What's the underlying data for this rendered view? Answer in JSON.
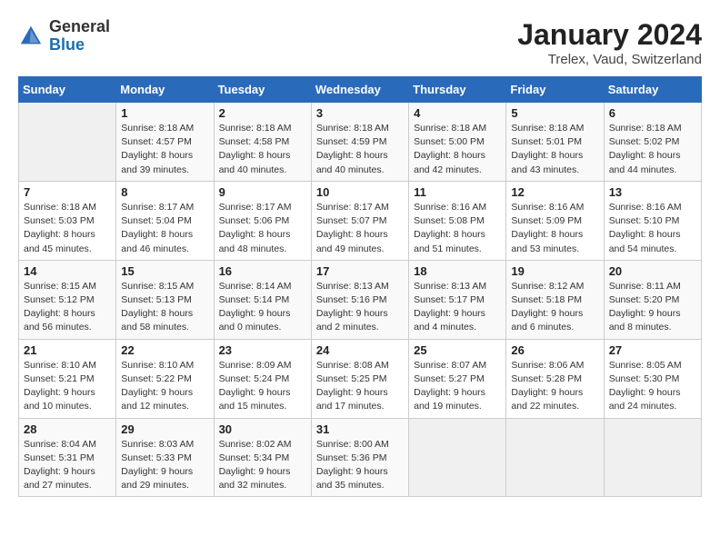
{
  "header": {
    "logo_general": "General",
    "logo_blue": "Blue",
    "title": "January 2024",
    "subtitle": "Trelex, Vaud, Switzerland"
  },
  "days_of_week": [
    "Sunday",
    "Monday",
    "Tuesday",
    "Wednesday",
    "Thursday",
    "Friday",
    "Saturday"
  ],
  "weeks": [
    [
      {
        "day": "",
        "sunrise": "",
        "sunset": "",
        "daylight": ""
      },
      {
        "day": "1",
        "sunrise": "Sunrise: 8:18 AM",
        "sunset": "Sunset: 4:57 PM",
        "daylight": "Daylight: 8 hours and 39 minutes."
      },
      {
        "day": "2",
        "sunrise": "Sunrise: 8:18 AM",
        "sunset": "Sunset: 4:58 PM",
        "daylight": "Daylight: 8 hours and 40 minutes."
      },
      {
        "day": "3",
        "sunrise": "Sunrise: 8:18 AM",
        "sunset": "Sunset: 4:59 PM",
        "daylight": "Daylight: 8 hours and 40 minutes."
      },
      {
        "day": "4",
        "sunrise": "Sunrise: 8:18 AM",
        "sunset": "Sunset: 5:00 PM",
        "daylight": "Daylight: 8 hours and 42 minutes."
      },
      {
        "day": "5",
        "sunrise": "Sunrise: 8:18 AM",
        "sunset": "Sunset: 5:01 PM",
        "daylight": "Daylight: 8 hours and 43 minutes."
      },
      {
        "day": "6",
        "sunrise": "Sunrise: 8:18 AM",
        "sunset": "Sunset: 5:02 PM",
        "daylight": "Daylight: 8 hours and 44 minutes."
      }
    ],
    [
      {
        "day": "7",
        "sunrise": "Sunrise: 8:18 AM",
        "sunset": "Sunset: 5:03 PM",
        "daylight": "Daylight: 8 hours and 45 minutes."
      },
      {
        "day": "8",
        "sunrise": "Sunrise: 8:17 AM",
        "sunset": "Sunset: 5:04 PM",
        "daylight": "Daylight: 8 hours and 46 minutes."
      },
      {
        "day": "9",
        "sunrise": "Sunrise: 8:17 AM",
        "sunset": "Sunset: 5:06 PM",
        "daylight": "Daylight: 8 hours and 48 minutes."
      },
      {
        "day": "10",
        "sunrise": "Sunrise: 8:17 AM",
        "sunset": "Sunset: 5:07 PM",
        "daylight": "Daylight: 8 hours and 49 minutes."
      },
      {
        "day": "11",
        "sunrise": "Sunrise: 8:16 AM",
        "sunset": "Sunset: 5:08 PM",
        "daylight": "Daylight: 8 hours and 51 minutes."
      },
      {
        "day": "12",
        "sunrise": "Sunrise: 8:16 AM",
        "sunset": "Sunset: 5:09 PM",
        "daylight": "Daylight: 8 hours and 53 minutes."
      },
      {
        "day": "13",
        "sunrise": "Sunrise: 8:16 AM",
        "sunset": "Sunset: 5:10 PM",
        "daylight": "Daylight: 8 hours and 54 minutes."
      }
    ],
    [
      {
        "day": "14",
        "sunrise": "Sunrise: 8:15 AM",
        "sunset": "Sunset: 5:12 PM",
        "daylight": "Daylight: 8 hours and 56 minutes."
      },
      {
        "day": "15",
        "sunrise": "Sunrise: 8:15 AM",
        "sunset": "Sunset: 5:13 PM",
        "daylight": "Daylight: 8 hours and 58 minutes."
      },
      {
        "day": "16",
        "sunrise": "Sunrise: 8:14 AM",
        "sunset": "Sunset: 5:14 PM",
        "daylight": "Daylight: 9 hours and 0 minutes."
      },
      {
        "day": "17",
        "sunrise": "Sunrise: 8:13 AM",
        "sunset": "Sunset: 5:16 PM",
        "daylight": "Daylight: 9 hours and 2 minutes."
      },
      {
        "day": "18",
        "sunrise": "Sunrise: 8:13 AM",
        "sunset": "Sunset: 5:17 PM",
        "daylight": "Daylight: 9 hours and 4 minutes."
      },
      {
        "day": "19",
        "sunrise": "Sunrise: 8:12 AM",
        "sunset": "Sunset: 5:18 PM",
        "daylight": "Daylight: 9 hours and 6 minutes."
      },
      {
        "day": "20",
        "sunrise": "Sunrise: 8:11 AM",
        "sunset": "Sunset: 5:20 PM",
        "daylight": "Daylight: 9 hours and 8 minutes."
      }
    ],
    [
      {
        "day": "21",
        "sunrise": "Sunrise: 8:10 AM",
        "sunset": "Sunset: 5:21 PM",
        "daylight": "Daylight: 9 hours and 10 minutes."
      },
      {
        "day": "22",
        "sunrise": "Sunrise: 8:10 AM",
        "sunset": "Sunset: 5:22 PM",
        "daylight": "Daylight: 9 hours and 12 minutes."
      },
      {
        "day": "23",
        "sunrise": "Sunrise: 8:09 AM",
        "sunset": "Sunset: 5:24 PM",
        "daylight": "Daylight: 9 hours and 15 minutes."
      },
      {
        "day": "24",
        "sunrise": "Sunrise: 8:08 AM",
        "sunset": "Sunset: 5:25 PM",
        "daylight": "Daylight: 9 hours and 17 minutes."
      },
      {
        "day": "25",
        "sunrise": "Sunrise: 8:07 AM",
        "sunset": "Sunset: 5:27 PM",
        "daylight": "Daylight: 9 hours and 19 minutes."
      },
      {
        "day": "26",
        "sunrise": "Sunrise: 8:06 AM",
        "sunset": "Sunset: 5:28 PM",
        "daylight": "Daylight: 9 hours and 22 minutes."
      },
      {
        "day": "27",
        "sunrise": "Sunrise: 8:05 AM",
        "sunset": "Sunset: 5:30 PM",
        "daylight": "Daylight: 9 hours and 24 minutes."
      }
    ],
    [
      {
        "day": "28",
        "sunrise": "Sunrise: 8:04 AM",
        "sunset": "Sunset: 5:31 PM",
        "daylight": "Daylight: 9 hours and 27 minutes."
      },
      {
        "day": "29",
        "sunrise": "Sunrise: 8:03 AM",
        "sunset": "Sunset: 5:33 PM",
        "daylight": "Daylight: 9 hours and 29 minutes."
      },
      {
        "day": "30",
        "sunrise": "Sunrise: 8:02 AM",
        "sunset": "Sunset: 5:34 PM",
        "daylight": "Daylight: 9 hours and 32 minutes."
      },
      {
        "day": "31",
        "sunrise": "Sunrise: 8:00 AM",
        "sunset": "Sunset: 5:36 PM",
        "daylight": "Daylight: 9 hours and 35 minutes."
      },
      {
        "day": "",
        "sunrise": "",
        "sunset": "",
        "daylight": ""
      },
      {
        "day": "",
        "sunrise": "",
        "sunset": "",
        "daylight": ""
      },
      {
        "day": "",
        "sunrise": "",
        "sunset": "",
        "daylight": ""
      }
    ]
  ]
}
